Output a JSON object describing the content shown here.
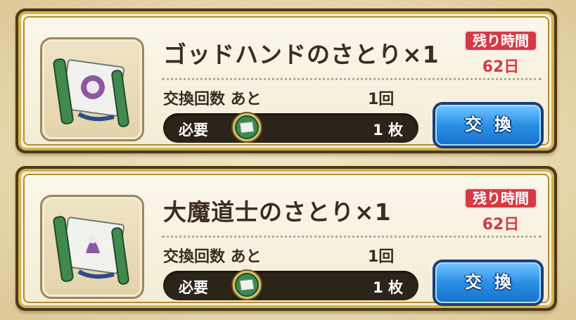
{
  "cards": [
    {
      "title": "ゴッドハンドのさとり×1",
      "remaining_label": "残り時間",
      "remaining_value": "62日",
      "count_label": "交換回数 あと",
      "count_value": "1回",
      "need_label": "必要",
      "need_value": "1 枚",
      "button_label": "交換",
      "item_icon": "scroll-icon",
      "need_icon": "medal-icon"
    },
    {
      "title": "大魔道士のさとり×1",
      "remaining_label": "残り時間",
      "remaining_value": "62日",
      "count_label": "交換回数 あと",
      "count_value": "1回",
      "need_label": "必要",
      "need_value": "1 枚",
      "button_label": "交換",
      "item_icon": "scroll-icon",
      "need_icon": "medal-icon"
    }
  ],
  "colors": {
    "badge_red": "#d53a44",
    "button_blue": "#2b8fe6",
    "card_gold": "#d9b04a"
  }
}
